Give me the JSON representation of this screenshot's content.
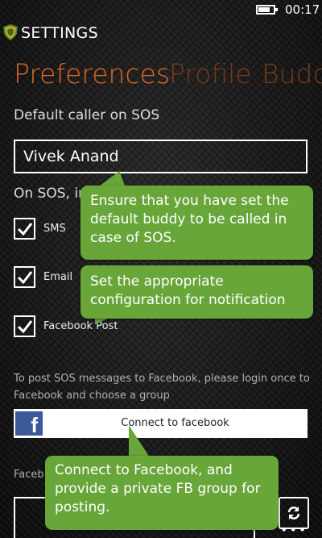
{
  "status_bar": {
    "time": "00:17",
    "battery_icon": "battery-icon"
  },
  "app": {
    "title": "SETTINGS",
    "logo_icon": "shield-icon"
  },
  "pivots": [
    {
      "label": "Preferences",
      "selected": true
    },
    {
      "label": "Profile",
      "selected": false
    },
    {
      "label": "Budd",
      "selected": false
    }
  ],
  "preferences": {
    "caller_label": "Default caller on SOS",
    "caller_value": "Vivek Anand",
    "on_sos_label": "On SOS, inf",
    "options": [
      {
        "label": "SMS",
        "checked": true
      },
      {
        "label": "Email",
        "checked": true
      },
      {
        "label": "Facebook Post",
        "checked": true
      }
    ],
    "fb_info": "To post SOS messages to Facebook, please login once to Facebook and choose a group",
    "connect_label": "Connect to facebook",
    "fb_group_label": "Faceb"
  },
  "tips": {
    "buddy": "Ensure that you have set the default buddy to be called in case of SOS.",
    "config": "Set the appropriate configuration for notification",
    "facebook": "Connect to Facebook, and provide a private FB group for posting."
  },
  "app_bar": {
    "more": "•••"
  },
  "colors": {
    "accent": "#e06a22",
    "tooltip": "#68a63a",
    "facebook": "#3b5998"
  }
}
